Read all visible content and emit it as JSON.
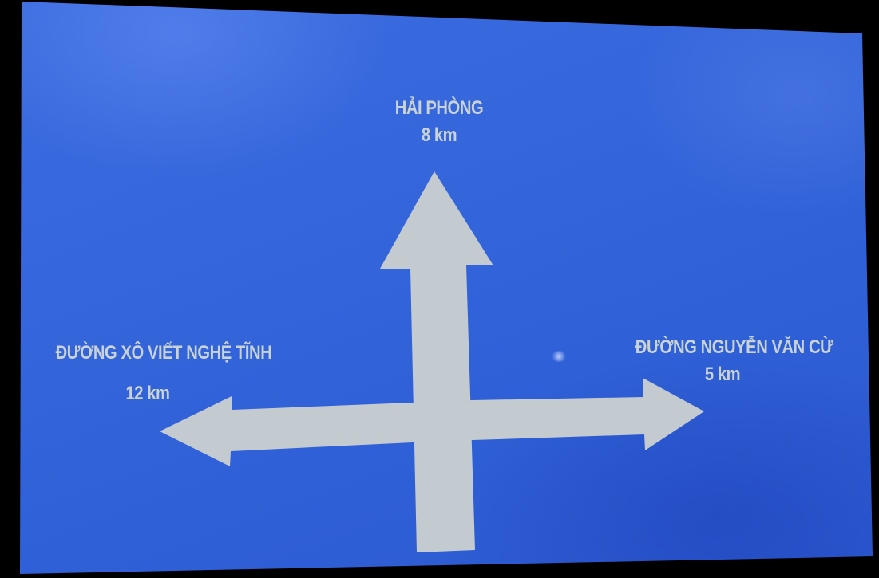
{
  "sign": {
    "background_color": "#3565db",
    "arrow_color": "#c3cbd0",
    "text_color": "#c9d3d6",
    "destinations": {
      "north": {
        "name": "HẢI PHÒNG",
        "distance": "8 km"
      },
      "west": {
        "name": "ĐƯỜNG XÔ VIẾT NGHỆ TĨNH",
        "distance": "12 km"
      },
      "east": {
        "name": "ĐƯỜNG NGUYỄN VĂN CỪ",
        "distance": "5 km"
      }
    }
  }
}
